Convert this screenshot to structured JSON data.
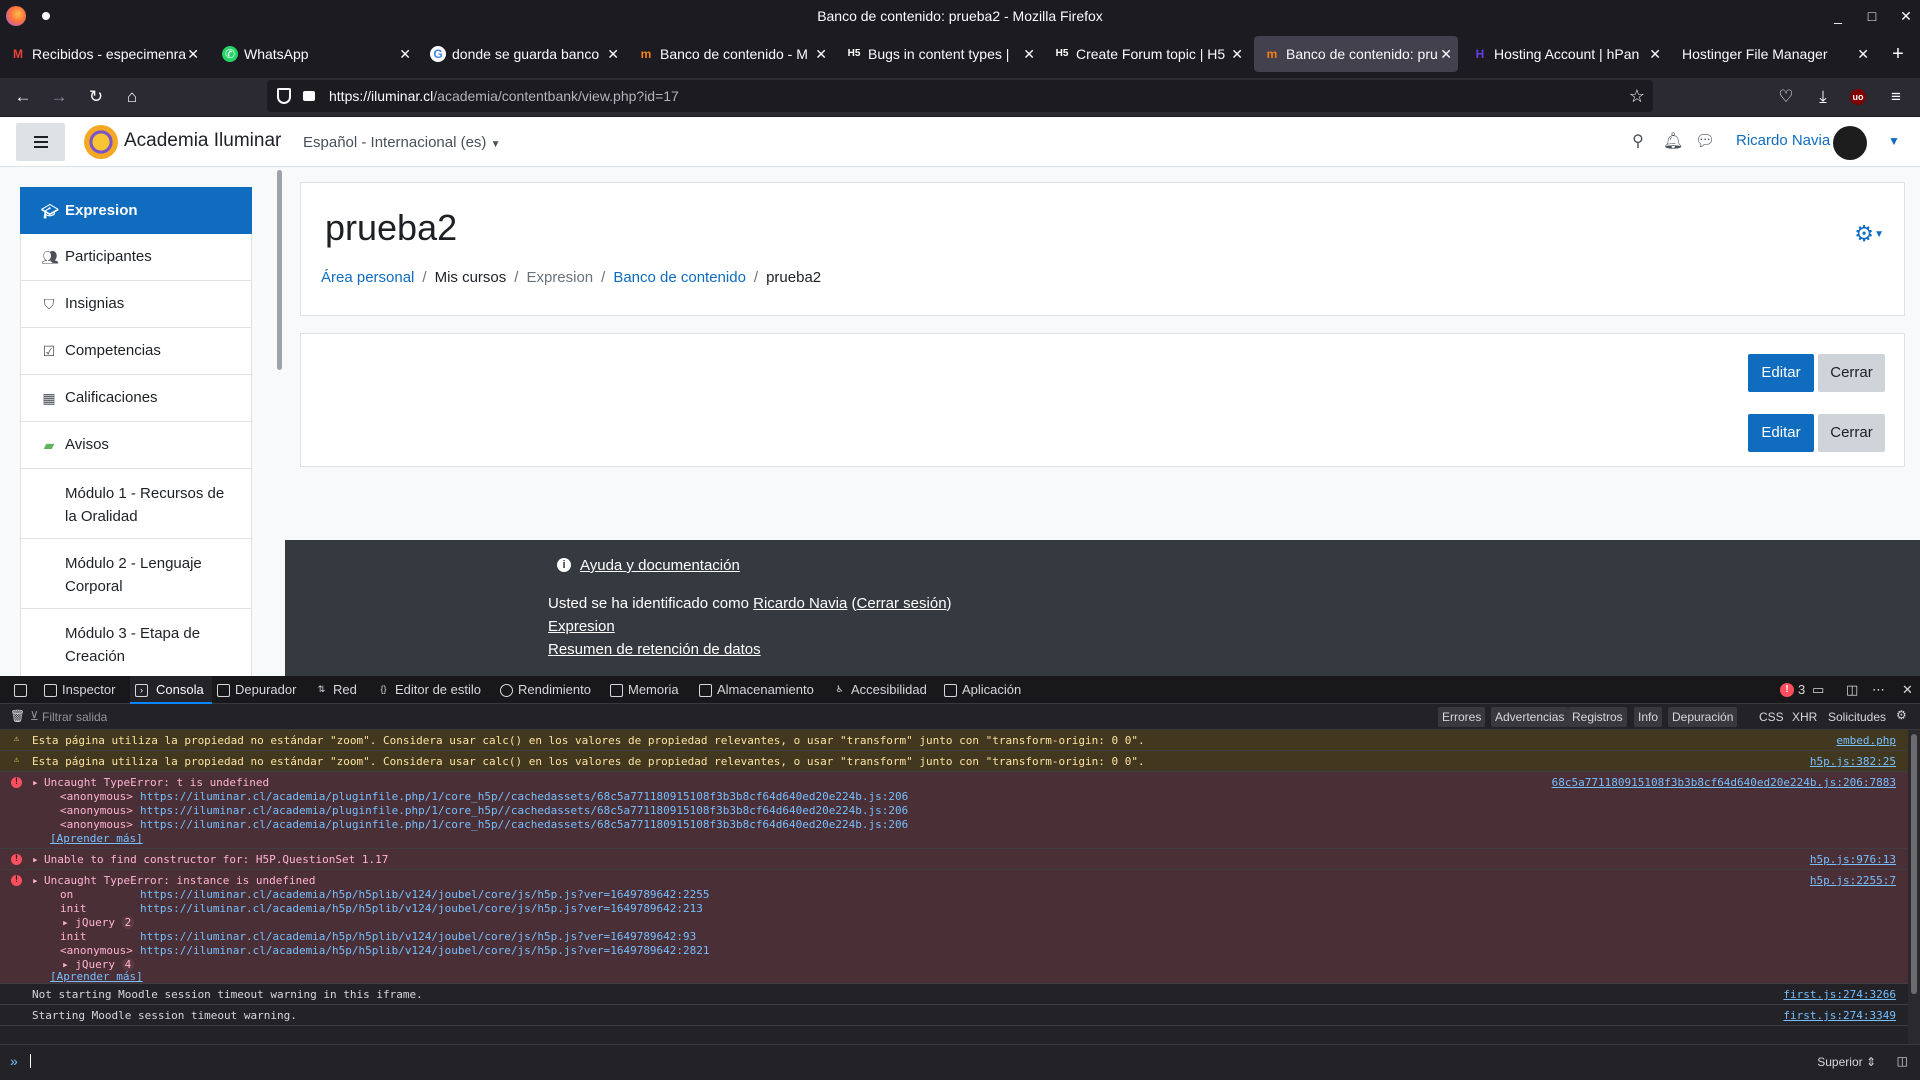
{
  "window": {
    "title": "Banco de contenido: prueba2 - Mozilla Firefox"
  },
  "tabs": [
    {
      "label": "Recibidos - especimenra",
      "icon": "gmail-icon",
      "active": false
    },
    {
      "label": "WhatsApp",
      "icon": "whatsapp-icon",
      "active": false
    },
    {
      "label": "donde se guarda banco",
      "icon": "google-icon",
      "active": false
    },
    {
      "label": "Banco de contenido - M",
      "icon": "moodle-icon",
      "active": false
    },
    {
      "label": "Bugs in content types |",
      "icon": "h5p-icon",
      "active": false
    },
    {
      "label": "Create Forum topic | H5",
      "icon": "h5p-icon",
      "active": false
    },
    {
      "label": "Banco de contenido: pru",
      "icon": "moodle-icon",
      "active": true
    },
    {
      "label": "Hosting Account | hPan",
      "icon": "hostinger-icon",
      "active": false
    },
    {
      "label": "Hostinger File Manager",
      "icon": "",
      "active": false
    }
  ],
  "url": {
    "host": "https://iluminar.cl",
    "rest": "/academia/contentbank/view.php?id=17"
  },
  "site": {
    "name": "Academia Iluminar",
    "language": "Español - Internacional (es)",
    "user": "Ricardo Navia"
  },
  "sidebar": {
    "items": [
      {
        "label": "Expresion",
        "icon": "course-icon"
      },
      {
        "label": "Participantes",
        "icon": "users-icon"
      },
      {
        "label": "Insignias",
        "icon": "shield-icon"
      },
      {
        "label": "Competencias",
        "icon": "checkbox-icon"
      },
      {
        "label": "Calificaciones",
        "icon": "table-icon"
      },
      {
        "label": "Avisos",
        "icon": "forum-icon"
      }
    ],
    "modules": [
      {
        "line1": "Módulo 1 - Recursos de",
        "line2": "la Oralidad"
      },
      {
        "line1": "Módulo 2 - Lenguaje",
        "line2": "Corporal"
      },
      {
        "line1": "Módulo 3 - Etapa de",
        "line2": "Creación"
      }
    ]
  },
  "main": {
    "title": "prueba2",
    "breadcrumb": [
      "Área personal",
      "Mis cursos",
      "Expresion",
      "Banco de contenido",
      "prueba2"
    ],
    "edit_label": "Editar",
    "close_label": "Cerrar"
  },
  "footer": {
    "help": "Ayuda y documentación",
    "logged_prefix": "Usted se ha identificado como",
    "logged_user": "Ricardo Navia",
    "logout": "Cerrar sesión",
    "course": "Expresion",
    "data_retention": "Resumen de retención de datos"
  },
  "devtools": {
    "tabs": [
      "Inspector",
      "Consola",
      "Depurador",
      "Red",
      "Editor de estilo",
      "Rendimiento",
      "Memoria",
      "Almacenamiento",
      "Accesibilidad",
      "Aplicación"
    ],
    "active_tab": "Consola",
    "error_count": "3",
    "filter_placeholder": "Filtrar salida",
    "filters": [
      "Errores",
      "Advertencias",
      "Registros",
      "Info",
      "Depuración"
    ],
    "filters2": [
      "CSS",
      "XHR",
      "Solicitudes"
    ],
    "messages": {
      "warn1": {
        "text": "Esta página utiliza la propiedad no estándar \"zoom\". Considera usar calc() en los valores de propiedad relevantes, o usar \"transform\" junto con \"transform-origin: 0 0\".",
        "src": "embed.php"
      },
      "warn2": {
        "text": "Esta página utiliza la propiedad no estándar \"zoom\". Considera usar calc() en los valores de propiedad relevantes, o usar \"transform\" junto con \"transform-origin: 0 0\".",
        "src": "h5p.js:382:25"
      },
      "err1": {
        "text": "Uncaught TypeError: t is undefined",
        "src": "68c5a771180915108f3b3b8cf64d640ed20e224b.js:206:7883",
        "frames": [
          {
            "fn": "<anonymous>",
            "url": "https://iluminar.cl/academia/pluginfile.php/1/core_h5p//cachedassets/68c5a771180915108f3b3b8cf64d640ed20e224b.js:206"
          },
          {
            "fn": "<anonymous>",
            "url": "https://iluminar.cl/academia/pluginfile.php/1/core_h5p//cachedassets/68c5a771180915108f3b3b8cf64d640ed20e224b.js:206"
          },
          {
            "fn": "<anonymous>",
            "url": "https://iluminar.cl/academia/pluginfile.php/1/core_h5p//cachedassets/68c5a771180915108f3b3b8cf64d640ed20e224b.js:206"
          }
        ],
        "learn": "[Aprender más]"
      },
      "err2": {
        "text": "Unable to find constructor for: H5P.QuestionSet 1.17",
        "src": "h5p.js:976:13"
      },
      "err3": {
        "text": "Uncaught TypeError: instance is undefined",
        "src": "h5p.js:2255:7",
        "frames": [
          {
            "fn": "on",
            "url": "https://iluminar.cl/academia/h5p/h5plib/v124/joubel/core/js/h5p.js?ver=1649789642:2255"
          },
          {
            "fn": "init",
            "url": "https://iluminar.cl/academia/h5p/h5plib/v124/joubel/core/js/h5p.js?ver=1649789642:213"
          },
          {
            "fn": "init",
            "url": "https://iluminar.cl/academia/h5p/h5plib/v124/joubel/core/js/h5p.js?ver=1649789642:93"
          },
          {
            "fn": "<anonymous>",
            "url": "https://iluminar.cl/academia/h5p/h5plib/v124/joubel/core/js/h5p.js?ver=1649789642:2821"
          }
        ],
        "jq1": "jQuery",
        "jq1_count": "2",
        "jq2": "jQuery",
        "jq2_count": "4",
        "learn": "[Aprender más]"
      },
      "log1": {
        "text": "Not starting Moodle session timeout warning in this iframe.",
        "src": "first.js:274:3266"
      },
      "log2": {
        "text": "Starting Moodle session timeout warning.",
        "src": "first.js:274:3349"
      }
    },
    "context": "Superior"
  }
}
